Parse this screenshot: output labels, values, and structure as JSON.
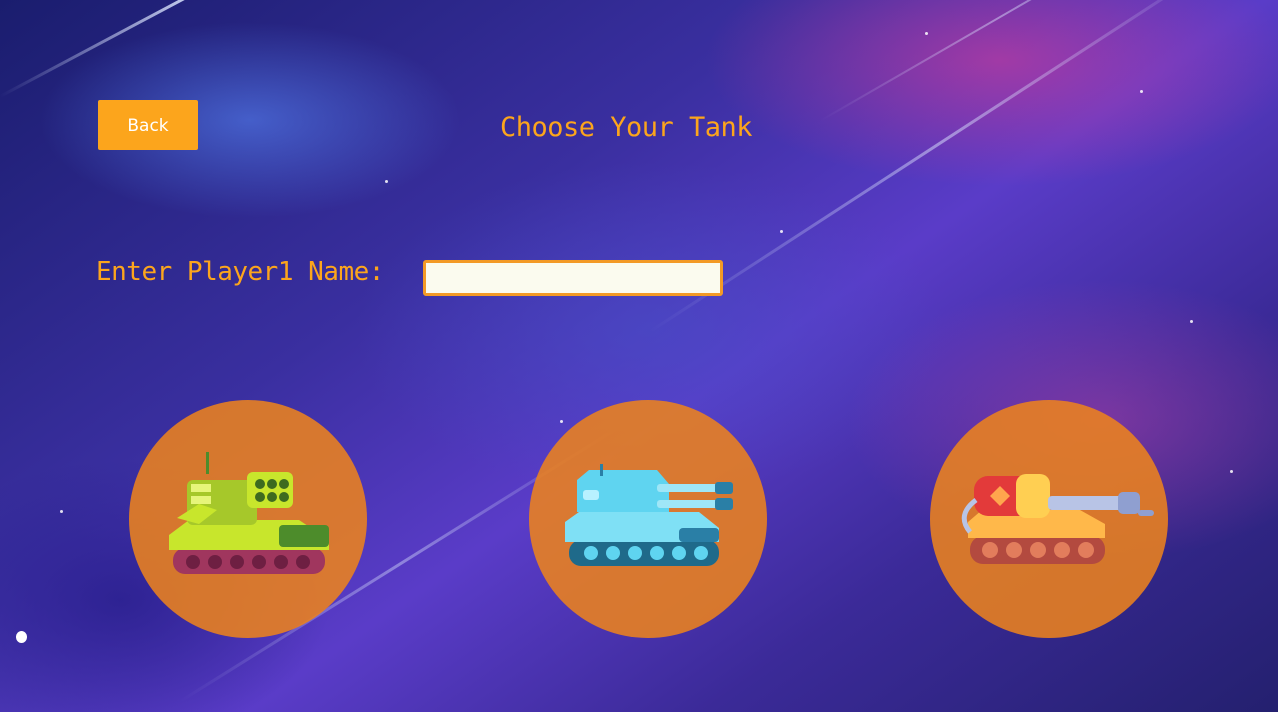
{
  "back_button": {
    "label": "Back"
  },
  "title": "Choose Your Tank",
  "player_name": {
    "label": "Enter Player1 Name:",
    "value": "",
    "placeholder": ""
  },
  "tanks": [
    {
      "icon": "green-rocket-tank-icon",
      "colors": {
        "body": "#c8e62c",
        "accent": "#4d8c2b",
        "tracks": "#a0365e"
      }
    },
    {
      "icon": "blue-twin-cannon-tank-icon",
      "colors": {
        "body": "#5fd4f0",
        "accent": "#2a7fa6",
        "tracks": "#1f6a8a"
      }
    },
    {
      "icon": "orange-gatling-tank-icon",
      "colors": {
        "body": "#ffb84a",
        "accent": "#e33a3a",
        "tracks": "#b34a3f"
      }
    }
  ],
  "colors": {
    "accent": "#fca51c",
    "circle": "#ec821e",
    "input_bg": "#fbfbef"
  }
}
